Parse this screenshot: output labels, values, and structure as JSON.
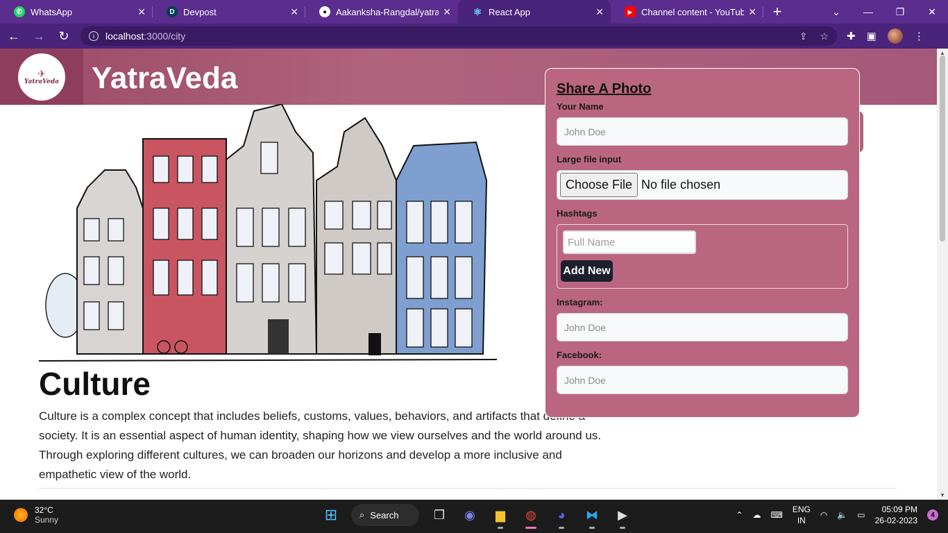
{
  "browser": {
    "tabs": [
      {
        "label": "WhatsApp",
        "icon": "whatsapp-icon",
        "color": "#25d366"
      },
      {
        "label": "Devpost",
        "icon": "devpost-icon",
        "color": "#003e54"
      },
      {
        "label": "Aakanksha-Rangdal/yatra-ve",
        "icon": "github-icon",
        "color": "#ffffff"
      },
      {
        "label": "React App",
        "icon": "react-icon",
        "color": "#61dafb"
      },
      {
        "label": "Channel content - YouTube S",
        "icon": "youtube-icon",
        "color": "#ff0000"
      }
    ],
    "active_tab_index": 3,
    "url_host": "localhost",
    "url_path": ":3000/city"
  },
  "site": {
    "brand": "YatraVeda",
    "logo_text": "YatraVeda"
  },
  "culture": {
    "title": "Culture",
    "text": "Culture is a complex concept that includes beliefs, customs, values, behaviors, and artifacts that define a society. It is an essential aspect of human identity, shaping how we view ourselves and the world around us. Through exploring different cultures, we can broaden our horizons and develop a more inclusive and empathetic view of the world."
  },
  "form": {
    "title": "Share A Photo",
    "name_label": "Your Name",
    "name_placeholder": "John Doe",
    "file_label": "Large file input",
    "file_button": "Choose File",
    "file_status": "No file chosen",
    "hashtags_label": "Hashtags",
    "hashtag_placeholder": "Full Name",
    "add_button": "Add New",
    "instagram_label": "Instagram:",
    "instagram_placeholder": "John Doe",
    "facebook_label": "Facebook:",
    "facebook_placeholder": "John Doe"
  },
  "taskbar": {
    "temp": "32°C",
    "condition": "Sunny",
    "search_label": "Search",
    "lang_top": "ENG",
    "lang_bottom": "IN",
    "time": "05:09 PM",
    "date": "26-02-2023",
    "notifications": "4"
  },
  "colors": {
    "chrome": "#5b2d8e",
    "header": "#b0637c",
    "panel": "#ba6680"
  }
}
